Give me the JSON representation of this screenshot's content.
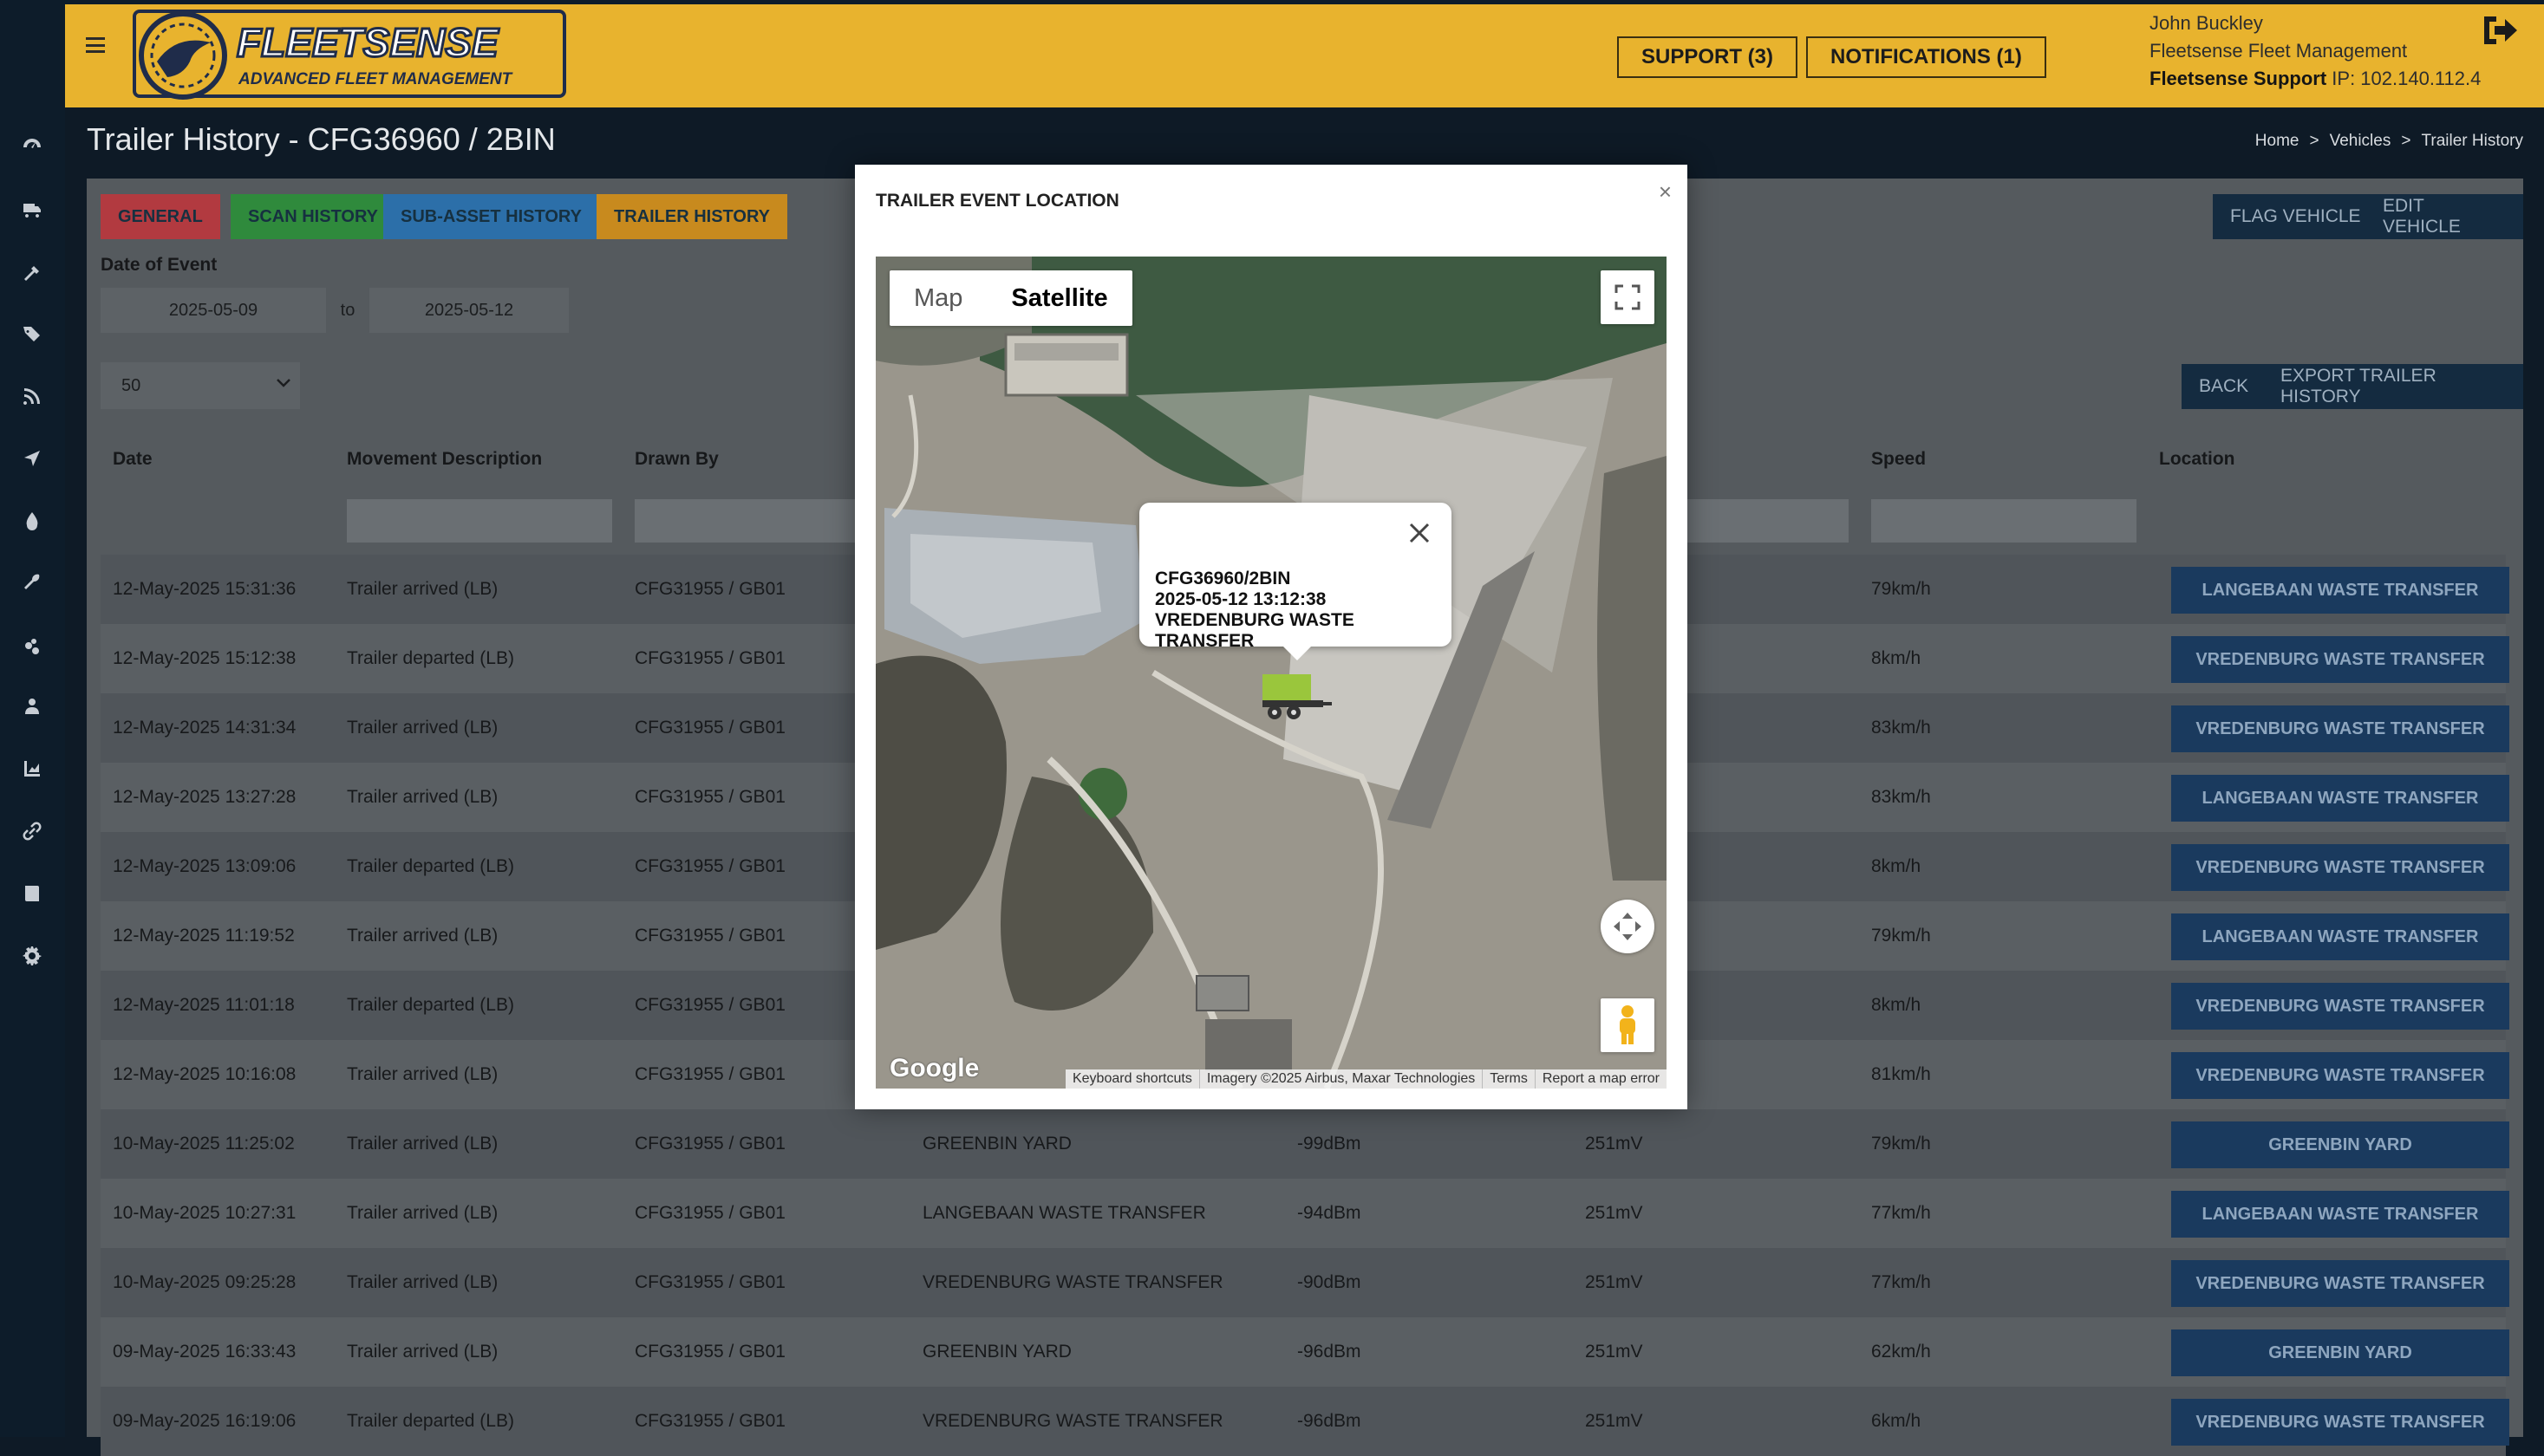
{
  "header": {
    "logo_name": "FLEETSENSE",
    "logo_tagline": "ADVANCED FLEET MANAGEMENT",
    "support_label": "SUPPORT (3)",
    "notifications_label": "NOTIFICATIONS (1)",
    "user_name": "John Buckley",
    "company": "Fleetsense Fleet Management",
    "support_account": "Fleetsense Support",
    "ip_text": "IP: 102.140.112.4"
  },
  "sidebar_icons": [
    "dashboard-icon",
    "truck-icon",
    "wrench-pipe-icon",
    "tag-icon",
    "rss-icon",
    "location-arrow-icon",
    "fuel-drop-icon",
    "wrench-icon",
    "cogs-icon",
    "user-icon",
    "chart-icon",
    "link-icon",
    "book-icon",
    "gear-icon"
  ],
  "page": {
    "title": "Trailer History - CFG36960 / 2BIN",
    "breadcrumb": [
      "Home",
      "Vehicles",
      "Trailer History"
    ],
    "breadcrumb_sep": ">"
  },
  "tabs": [
    {
      "label": "GENERAL",
      "color": "#b23a40"
    },
    {
      "label": "SCAN HISTORY",
      "color": "#2f8a3c"
    },
    {
      "label": "SUB-ASSET HISTORY",
      "color": "#2c6fa9"
    },
    {
      "label": "TRAILER HISTORY",
      "color": "#c88a1e"
    }
  ],
  "actions": {
    "flag": "FLAG VEHICLE",
    "edit": "EDIT VEHICLE",
    "back": "BACK",
    "export": "EXPORT TRAILER HISTORY"
  },
  "filters": {
    "date_label": "Date of Event",
    "date_from": "2025-05-09",
    "date_to_label": "to",
    "date_to": "2025-05-12",
    "page_size": "50"
  },
  "table": {
    "headers": [
      "Date",
      "Movement Description",
      "Drawn By",
      "Speed",
      "Location"
    ],
    "rows": [
      {
        "date": "12-May-2025 15:31:36",
        "desc": "Trailer arrived (LB)",
        "drawn": "CFG31955 / GB01",
        "place": "",
        "signal": "",
        "voltage": "",
        "speed": "79km/h",
        "location": "LANGEBAAN WASTE TRANSFER"
      },
      {
        "date": "12-May-2025 15:12:38",
        "desc": "Trailer departed (LB)",
        "drawn": "CFG31955 / GB01",
        "place": "",
        "signal": "",
        "voltage": "",
        "speed": "8km/h",
        "location": "VREDENBURG WASTE TRANSFER"
      },
      {
        "date": "12-May-2025 14:31:34",
        "desc": "Trailer arrived (LB)",
        "drawn": "CFG31955 / GB01",
        "place": "",
        "signal": "",
        "voltage": "",
        "speed": "83km/h",
        "location": "VREDENBURG WASTE TRANSFER"
      },
      {
        "date": "12-May-2025 13:27:28",
        "desc": "Trailer arrived (LB)",
        "drawn": "CFG31955 / GB01",
        "place": "",
        "signal": "",
        "voltage": "",
        "speed": "83km/h",
        "location": "LANGEBAAN WASTE TRANSFER"
      },
      {
        "date": "12-May-2025 13:09:06",
        "desc": "Trailer departed (LB)",
        "drawn": "CFG31955 / GB01",
        "place": "",
        "signal": "",
        "voltage": "",
        "speed": "8km/h",
        "location": "VREDENBURG WASTE TRANSFER"
      },
      {
        "date": "12-May-2025 11:19:52",
        "desc": "Trailer arrived (LB)",
        "drawn": "CFG31955 / GB01",
        "place": "",
        "signal": "",
        "voltage": "",
        "speed": "79km/h",
        "location": "LANGEBAAN WASTE TRANSFER"
      },
      {
        "date": "12-May-2025 11:01:18",
        "desc": "Trailer departed (LB)",
        "drawn": "CFG31955 / GB01",
        "place": "",
        "signal": "",
        "voltage": "",
        "speed": "8km/h",
        "location": "VREDENBURG WASTE TRANSFER"
      },
      {
        "date": "12-May-2025 10:16:08",
        "desc": "Trailer arrived (LB)",
        "drawn": "CFG31955 / GB01",
        "place": "",
        "signal": "",
        "voltage": "",
        "speed": "81km/h",
        "location": "VREDENBURG WASTE TRANSFER"
      },
      {
        "date": "10-May-2025 11:25:02",
        "desc": "Trailer arrived (LB)",
        "drawn": "CFG31955 / GB01",
        "place": "GREENBIN YARD",
        "signal": "-99dBm",
        "voltage": "251mV",
        "speed": "79km/h",
        "location": "GREENBIN YARD"
      },
      {
        "date": "10-May-2025 10:27:31",
        "desc": "Trailer arrived (LB)",
        "drawn": "CFG31955 / GB01",
        "place": "LANGEBAAN WASTE TRANSFER",
        "signal": "-94dBm",
        "voltage": "251mV",
        "speed": "77km/h",
        "location": "LANGEBAAN WASTE TRANSFER"
      },
      {
        "date": "10-May-2025 09:25:28",
        "desc": "Trailer arrived (LB)",
        "drawn": "CFG31955 / GB01",
        "place": "VREDENBURG WASTE TRANSFER",
        "signal": "-90dBm",
        "voltage": "251mV",
        "speed": "77km/h",
        "location": "VREDENBURG WASTE TRANSFER"
      },
      {
        "date": "09-May-2025 16:33:43",
        "desc": "Trailer arrived (LB)",
        "drawn": "CFG31955 / GB01",
        "place": "GREENBIN YARD",
        "signal": "-96dBm",
        "voltage": "251mV",
        "speed": "62km/h",
        "location": "GREENBIN YARD"
      },
      {
        "date": "09-May-2025 16:19:06",
        "desc": "Trailer departed (LB)",
        "drawn": "CFG31955 / GB01",
        "place": "VREDENBURG WASTE TRANSFER",
        "signal": "-96dBm",
        "voltage": "251mV",
        "speed": "6km/h",
        "location": "VREDENBURG WASTE TRANSFER"
      }
    ]
  },
  "modal": {
    "title": "TRAILER EVENT LOCATION",
    "close": "×",
    "map_type": [
      "Map",
      "Satellite"
    ],
    "selected_map_type": "Satellite",
    "info_lines": [
      "CFG36960/2BIN",
      "2025-05-12 13:12:38",
      "VREDENBURG WASTE TRANSFER"
    ],
    "google": "Google",
    "attribution": [
      "Keyboard shortcuts",
      "Imagery ©2025 Airbus, Maxar Technologies",
      "Terms",
      "Report a map error"
    ]
  },
  "colors": {
    "header": "#e8b32e",
    "panel": "#555a5e",
    "location_button": "#1a3a5e",
    "action_button": "#142b40"
  }
}
